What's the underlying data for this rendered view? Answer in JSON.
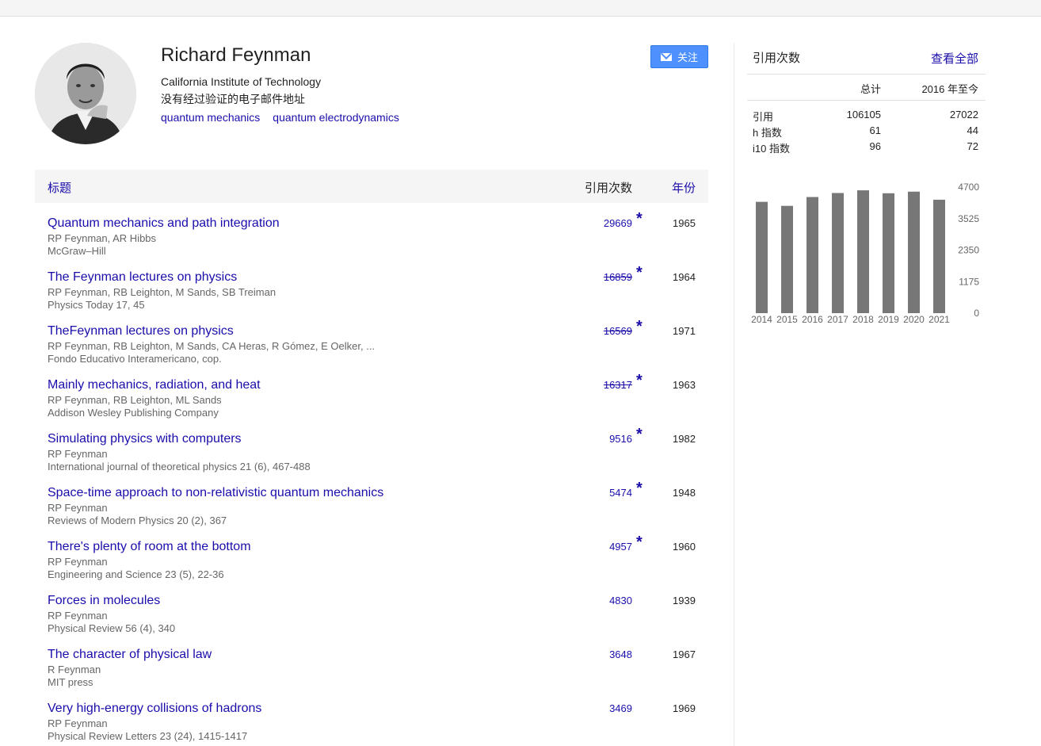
{
  "profile": {
    "name": "Richard Feynman",
    "affiliation": "California Institute of Technology",
    "email_status": "没有经过验证的电子邮件地址",
    "interests": [
      "quantum mechanics",
      "quantum electrodynamics"
    ],
    "follow_label": "关注"
  },
  "table": {
    "header_title": "标题",
    "header_cites": "引用次数",
    "header_year": "年份",
    "rows": [
      {
        "title": "Quantum mechanics and path integration",
        "authors": "RP Feynman, AR Hibbs",
        "venue": "McGraw–Hill",
        "cites": "29669",
        "star": "*",
        "year": "1965",
        "strike": false
      },
      {
        "title": "The Feynman lectures on physics",
        "authors": "RP Feynman, RB Leighton, M Sands, SB Treiman",
        "venue": "Physics Today 17, 45",
        "cites": "16859",
        "star": "*",
        "year": "1964",
        "strike": true
      },
      {
        "title": "TheFeynman lectures on physics",
        "authors": "RP Feynman, RB Leighton, M Sands, CA Heras, R Gómez, E Oelker, ...",
        "venue": "Fondo Educativo Interamericano, cop.",
        "cites": "16569",
        "star": "*",
        "year": "1971",
        "strike": true
      },
      {
        "title": "Mainly mechanics, radiation, and heat",
        "authors": "RP Feynman, RB Leighton, ML Sands",
        "venue": "Addison Wesley Publishing Company",
        "cites": "16317",
        "star": "*",
        "year": "1963",
        "strike": true
      },
      {
        "title": "Simulating physics with computers",
        "authors": "RP Feynman",
        "venue": "International journal of theoretical physics 21 (6), 467-488",
        "cites": "9516",
        "star": "*",
        "year": "1982",
        "strike": false
      },
      {
        "title": "Space-time approach to non-relativistic quantum mechanics",
        "authors": "RP Feynman",
        "venue": "Reviews of Modern Physics 20 (2), 367",
        "cites": "5474",
        "star": "*",
        "year": "1948",
        "strike": false
      },
      {
        "title": "There's plenty of room at the bottom",
        "authors": "RP Feynman",
        "venue": "Engineering and Science 23 (5), 22-36",
        "cites": "4957",
        "star": "*",
        "year": "1960",
        "strike": false
      },
      {
        "title": "Forces in molecules",
        "authors": "RP Feynman",
        "venue": "Physical Review 56 (4), 340",
        "cites": "4830",
        "star": "",
        "year": "1939",
        "strike": false
      },
      {
        "title": "The character of physical law",
        "authors": "R Feynman",
        "venue": "MIT press",
        "cites": "3648",
        "star": "",
        "year": "1967",
        "strike": false
      },
      {
        "title": "Very high-energy collisions of hadrons",
        "authors": "RP Feynman",
        "venue": "Physical Review Letters 23 (24), 1415-1417",
        "cites": "3469",
        "star": "",
        "year": "1969",
        "strike": false
      }
    ]
  },
  "sidebar": {
    "title": "引用次数",
    "view_all": "查看全部",
    "col_all": "总计",
    "col_since": "2016 年至今",
    "stats": [
      {
        "label": "引用",
        "all": "106105",
        "since": "27022"
      },
      {
        "label": "h 指数",
        "all": "61",
        "since": "44"
      },
      {
        "label": "i10 指数",
        "all": "96",
        "since": "72"
      }
    ]
  },
  "chart_data": {
    "type": "bar",
    "categories": [
      "2014",
      "2015",
      "2016",
      "2017",
      "2018",
      "2019",
      "2020",
      "2021"
    ],
    "values": [
      4150,
      4000,
      4330,
      4480,
      4580,
      4470,
      4530,
      4230
    ],
    "ylim": [
      0,
      4700
    ],
    "yticks": [
      "4700",
      "3525",
      "2350",
      "1175",
      "0"
    ],
    "bar_color": "#777777"
  }
}
